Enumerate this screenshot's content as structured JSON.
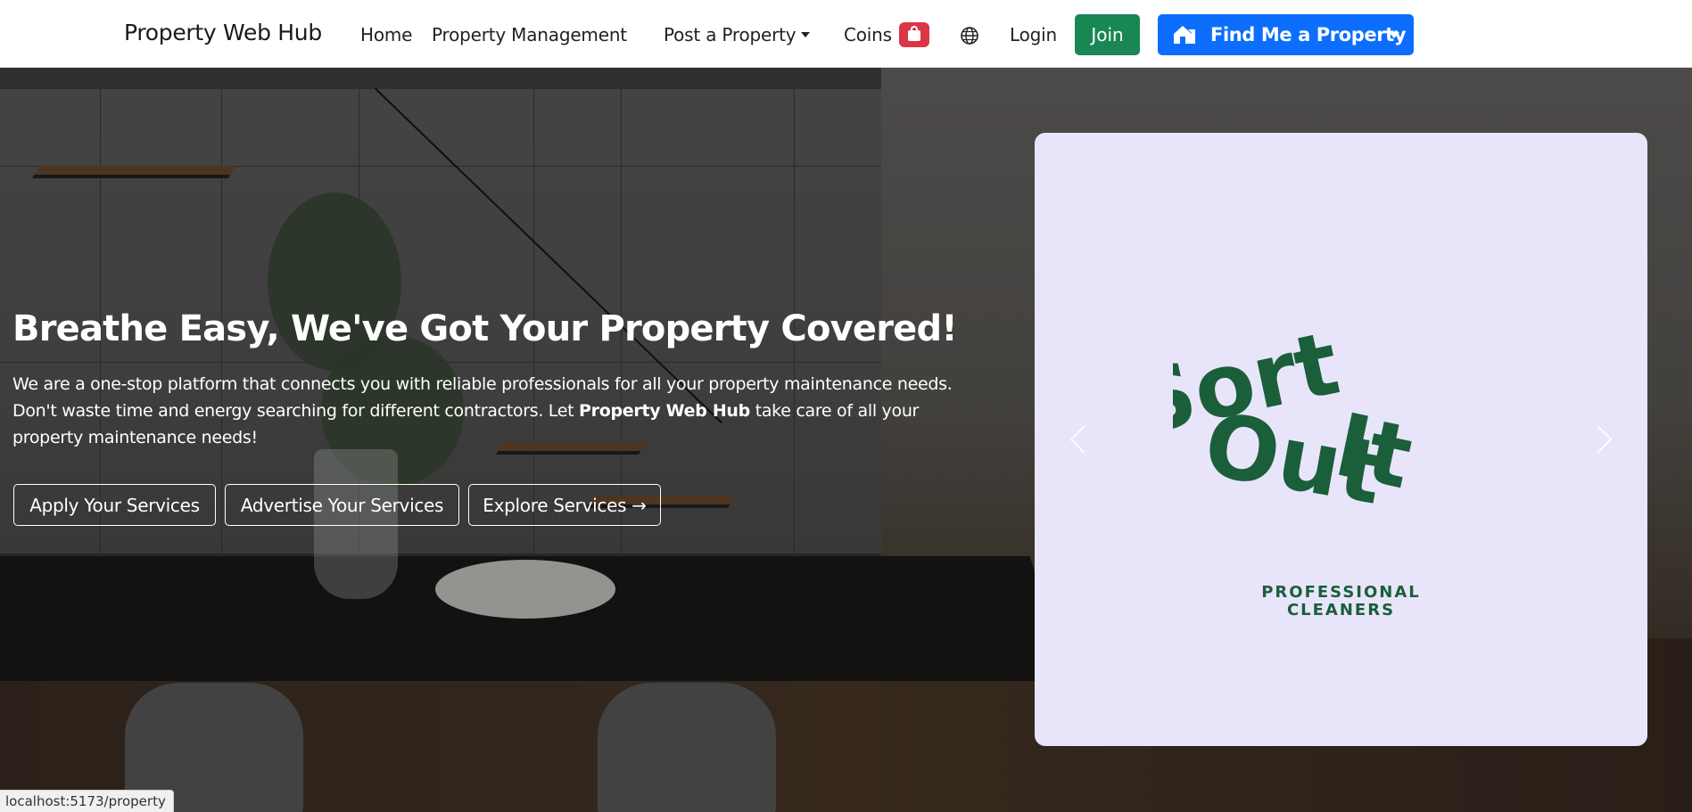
{
  "navbar": {
    "brand": "Property Web Hub",
    "links": {
      "home": "Home",
      "property_management": "Property Management",
      "post_property": "Post a Property",
      "coins": "Coins",
      "login": "Login"
    },
    "join_label": "Join",
    "find_label": "Find Me a Property",
    "icons": {
      "coins_badge": "shopping-bag-icon",
      "language": "globe-icon",
      "find": "house-icon"
    },
    "colors": {
      "join": "#198754",
      "find": "#0d6efd",
      "coins_badge": "#dc3545"
    }
  },
  "hero": {
    "title": "Breathe Easy, We've Got Your Property Covered!",
    "desc_part1": "We are a one-stop platform that connects you with reliable professionals for all your property maintenance needs. Don't waste time and energy searching for different contractors. Let ",
    "desc_brand": "Property Web Hub",
    "desc_part2": " take care of all your property maintenance needs!",
    "buttons": {
      "apply": "Apply Your Services",
      "advertise": "Advertise Your Services",
      "explore": "Explore Services →"
    }
  },
  "carousel": {
    "logo_words": [
      "Sort",
      "It",
      "Out"
    ],
    "logo_sub_line1": "PROFESSIONAL",
    "logo_sub_line2": "CLEANERS",
    "background": "#e8e5fb",
    "logo_color": "#1b5e3a",
    "slide_count": 7,
    "active_index": 6
  },
  "status_bar": {
    "url": "localhost:5173/property"
  }
}
